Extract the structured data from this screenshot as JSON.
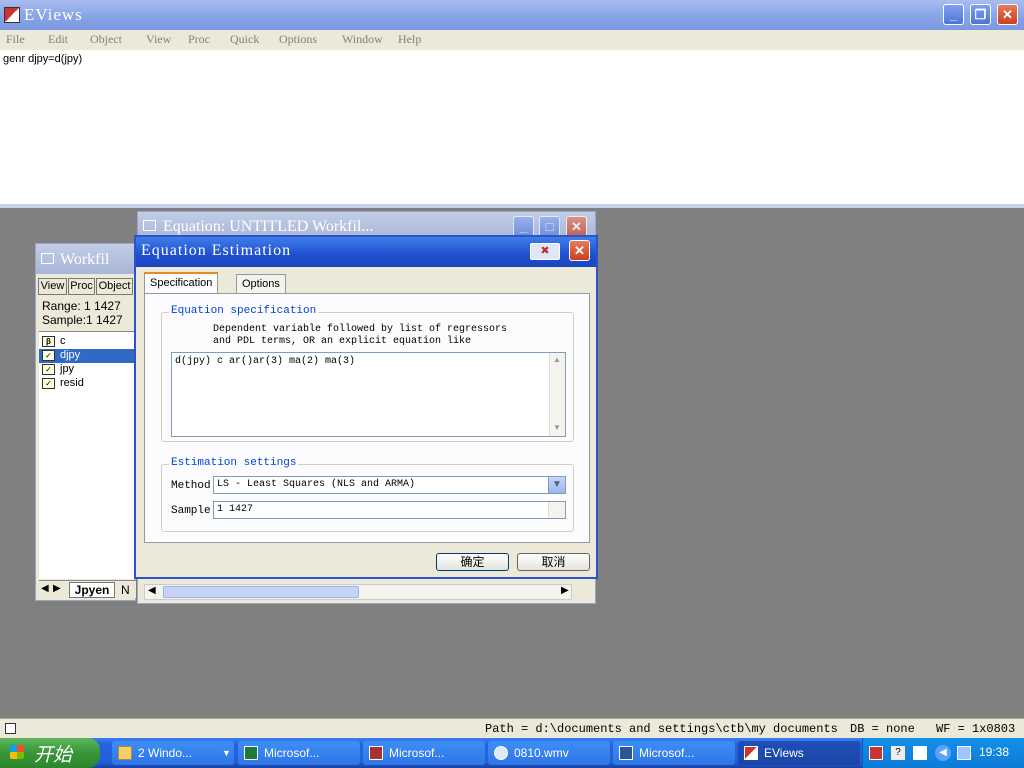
{
  "app": {
    "title": "EViews"
  },
  "menu": {
    "items": [
      "File",
      "Edit",
      "Object",
      "View",
      "Proc",
      "Quick",
      "Options",
      "Window",
      "Help"
    ]
  },
  "command": {
    "text": "genr djpy=d(jpy)"
  },
  "workfile": {
    "title": "Workfil",
    "buttons": [
      "View",
      "Proc",
      "Object"
    ],
    "range_label": "Range:",
    "range_value": "1 1427",
    "sample_label": "Sample:",
    "sample_value": "1 1427",
    "objects": [
      {
        "name": "c",
        "icon": "beta-icon"
      },
      {
        "name": "djpy",
        "icon": "series-icon",
        "selected": true
      },
      {
        "name": "jpy",
        "icon": "series-icon"
      },
      {
        "name": "resid",
        "icon": "series-icon"
      }
    ],
    "tab_active": "Jpyen",
    "tab_next": "N"
  },
  "equation_window": {
    "title": "Equation: UNTITLED   Workfil..."
  },
  "dialog": {
    "title": "Equation Estimation",
    "tabs": [
      "Specification",
      "Options"
    ],
    "spec_group": "Equation specification",
    "spec_desc_1": "Dependent variable followed by list of regressors",
    "spec_desc_2": "and PDL terms, OR an explicit equation like",
    "spec_value": "d(jpy) c ar()ar(3) ma(2) ma(3)",
    "est_group": "Estimation settings",
    "method_label": "Method:",
    "method_value": "LS  -  Least Squares (NLS and ARMA)",
    "sample_label": "Sample:",
    "sample_value": "1 1427",
    "ok_label": "确定",
    "cancel_label": "取消"
  },
  "status": {
    "path": "Path = d:\\documents and settings\\ctb\\my documents",
    "db": "DB = none",
    "wf": "WF = 1x0803"
  },
  "taskbar": {
    "start": "开始",
    "items": [
      {
        "label": "2 Windo...",
        "icon": "folder-icon"
      },
      {
        "label": "Microsof...",
        "icon": "excel-icon"
      },
      {
        "label": "Microsof...",
        "icon": "access-icon"
      },
      {
        "label": "0810.wmv",
        "icon": "media-icon"
      },
      {
        "label": "Microsof...",
        "icon": "word-icon"
      },
      {
        "label": "EViews",
        "icon": "eviews-icon",
        "active": true
      }
    ],
    "clock": "19:38"
  }
}
